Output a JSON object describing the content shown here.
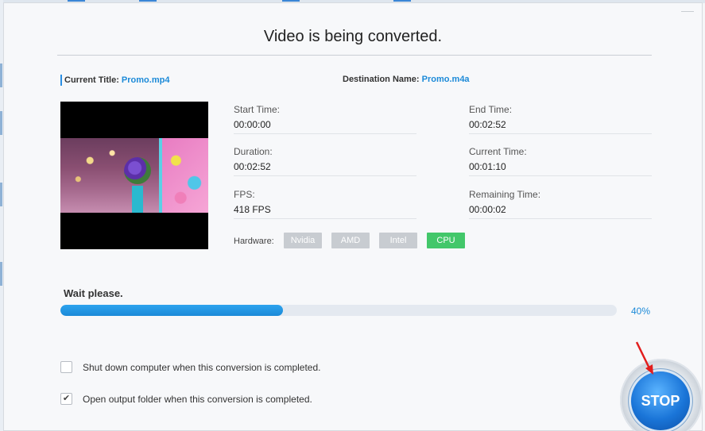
{
  "dialog": {
    "title": "Video is being converted."
  },
  "info": {
    "current_title_label": "Current Title:",
    "current_title_value": "Promo.mp4",
    "destination_label": "Destination Name:",
    "destination_value": "Promo.m4a"
  },
  "fields": {
    "start_time": {
      "label": "Start Time:",
      "value": "00:00:00"
    },
    "end_time": {
      "label": "End Time:",
      "value": "00:02:52"
    },
    "duration": {
      "label": "Duration:",
      "value": "00:02:52"
    },
    "current_time": {
      "label": "Current Time:",
      "value": "00:01:10"
    },
    "fps": {
      "label": "FPS:",
      "value": "418 FPS"
    },
    "remaining_time": {
      "label": "Remaining Time:",
      "value": "00:00:02"
    }
  },
  "hardware": {
    "label": "Hardware:",
    "options": [
      "Nvidia",
      "AMD",
      "Intel",
      "CPU"
    ],
    "active": "CPU",
    "active_color": "#43c76a",
    "inactive_color": "#c8ccd1"
  },
  "progress": {
    "status_text": "Wait please.",
    "percent_text": "40%",
    "fraction": 0.4,
    "color": "#1b8ad8"
  },
  "options": {
    "shutdown_label": "Shut down computer when this conversion is completed.",
    "shutdown_checked": false,
    "open_folder_label": "Open output folder when this conversion is completed.",
    "open_folder_checked": true
  },
  "stop_button": {
    "label": "STOP",
    "color": "#1a75d8"
  }
}
